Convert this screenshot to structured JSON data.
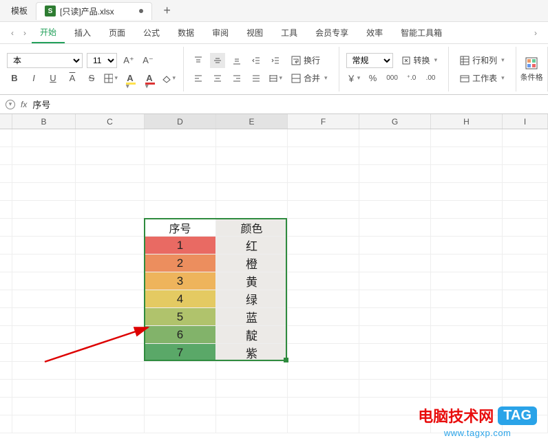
{
  "tabs": {
    "template_label": "模板",
    "doc_icon_letter": "S",
    "doc_title": "[只读]产品.xlsx",
    "newtab_glyph": "+"
  },
  "menu": {
    "items": [
      "开始",
      "插入",
      "页面",
      "公式",
      "数据",
      "审阅",
      "视图",
      "工具",
      "会员专享",
      "效率",
      "智能工具箱"
    ],
    "active_index": 0
  },
  "ribbon": {
    "font_name": "本",
    "font_size": "11",
    "a_plus": "A⁺",
    "a_minus": "A⁻",
    "bold": "B",
    "italic": "I",
    "underline": "U",
    "overline": "A",
    "strike": "S",
    "wrap_label": "换行",
    "merge_label": "合并",
    "number_format": "常规",
    "convert_label": "转换",
    "currency": "￥",
    "percent": "%",
    "thousands": "000",
    "dec_inc": "⁺.0",
    "dec_dec": ".00",
    "rows_cols_label": "行和列",
    "worksheet_label": "工作表",
    "cond_fmt_label": "条件格"
  },
  "fx": {
    "fx_label": "fx",
    "cell_value": "序号"
  },
  "columns": [
    "B",
    "C",
    "D",
    "E",
    "F",
    "G",
    "H",
    "I"
  ],
  "selected_cols": [
    "D",
    "E"
  ],
  "chart_data": {
    "type": "table",
    "headers": [
      "序号",
      "颜色"
    ],
    "rows": [
      {
        "num": "1",
        "color_name": "红",
        "bg": "#e96a63"
      },
      {
        "num": "2",
        "color_name": "橙",
        "bg": "#ec8e5e"
      },
      {
        "num": "3",
        "color_name": "黄",
        "bg": "#eeb45c"
      },
      {
        "num": "4",
        "color_name": "绿",
        "bg": "#e4ca62"
      },
      {
        "num": "5",
        "color_name": "蓝",
        "bg": "#b0c36c"
      },
      {
        "num": "6",
        "color_name": "靛",
        "bg": "#82b36a"
      },
      {
        "num": "7",
        "color_name": "紫",
        "bg": "#5aa868"
      }
    ],
    "e_col_bg": "#eceae7"
  },
  "watermark": {
    "text": "电脑技术网",
    "tag": "TAG",
    "url": "www.tagxp.com"
  }
}
